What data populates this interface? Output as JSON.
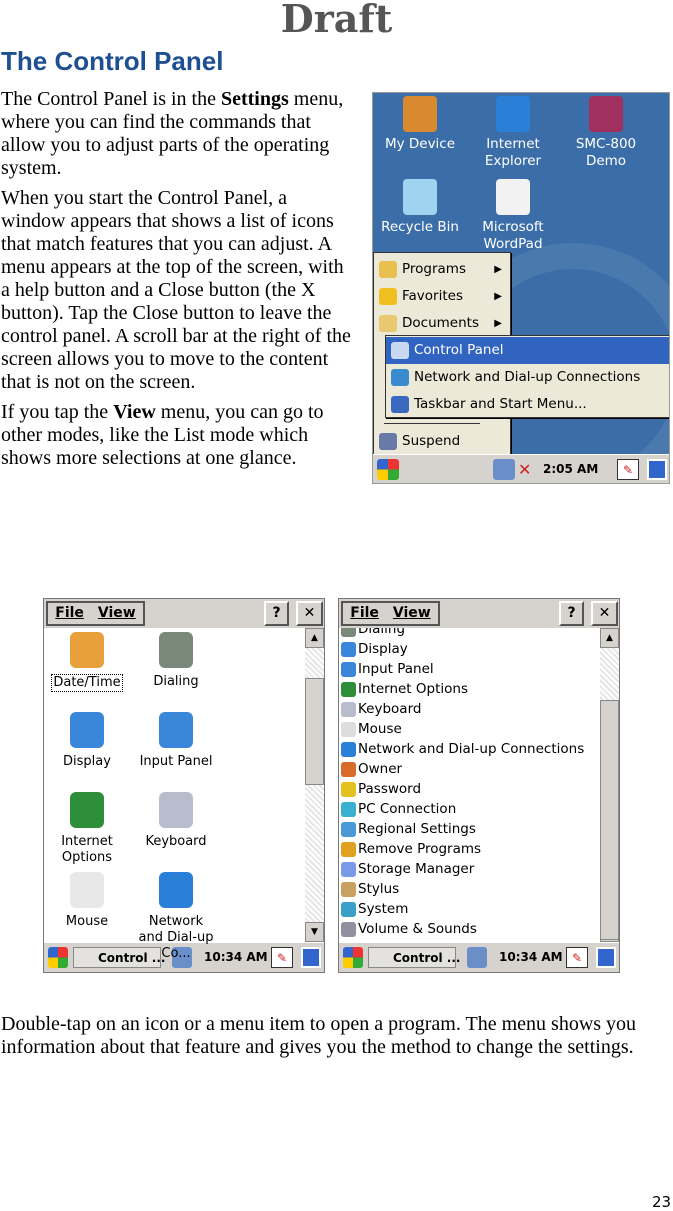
{
  "watermark": "Draft",
  "heading": "The Control Panel",
  "paragraphs": [
    {
      "before": "The Control Panel is in the ",
      "bold": "Settings",
      "after": " menu, where you can find the commands that allow you to adjust parts of the operating system."
    },
    {
      "before": "When you start the Control Panel, a window appears that shows a list of icons that match features that you can adjust. A menu appears at the top of the screen, with a help button and a Close button (the X button). Tap the Close button to leave the control panel. A scroll bar at the right of the screen allows you to move to the content that is not on the screen.",
      "bold": "",
      "after": ""
    },
    {
      "before": "If you tap the ",
      "bold": "View",
      "after": " menu, you can go to other modes, like the List mode which shows more selections at one glance."
    }
  ],
  "closing": "Double-tap on an icon or a menu item to open a program. The menu shows you information about that feature and gives you the method to change the settings.",
  "page_number": "23",
  "desktop": {
    "icons": [
      {
        "label": "My Device",
        "icon": "pda-icon",
        "color": "#d9892e"
      },
      {
        "label": "Internet Explorer",
        "icon": "ie-icon",
        "color": "#2a7fd6"
      },
      {
        "label": "SMC-800 Demo",
        "icon": "smc-icon",
        "color": "#a03060"
      },
      {
        "label": "Recycle Bin",
        "icon": "recycle-bin-icon",
        "color": "#9fd3f0"
      },
      {
        "label": "Microsoft WordPad",
        "icon": "wordpad-icon",
        "color": "#f2f2f2"
      }
    ],
    "start_menu": [
      {
        "label": "Programs",
        "icon": "programs-icon",
        "submenu": true
      },
      {
        "label": "Favorites",
        "icon": "favorites-star-icon",
        "submenu": true
      },
      {
        "label": "Documents",
        "icon": "documents-icon",
        "submenu": true
      },
      {
        "label": "Suspend",
        "icon": "suspend-icon",
        "submenu": false
      }
    ],
    "settings_submenu": [
      {
        "label": "Control Panel",
        "icon": "control-panel-icon",
        "selected": true
      },
      {
        "label": "Network and Dial-up Connections",
        "icon": "network-icon",
        "selected": false
      },
      {
        "label": "Taskbar and Start Menu...",
        "icon": "taskbar-icon",
        "selected": false
      }
    ],
    "taskbar": {
      "time": "2:05 AM"
    },
    "highlight_color": "#3163c0"
  },
  "window": {
    "menu": [
      "File",
      "View"
    ],
    "help": "?",
    "close": "✕",
    "taskbar": {
      "task": "Control ...",
      "time": "10:34 AM"
    }
  },
  "icon_view": [
    {
      "label": "Date/Time",
      "color": "#e8a03a"
    },
    {
      "label": "Dialing",
      "color": "#7a8a7a"
    },
    {
      "label": "Display",
      "color": "#3a86d8"
    },
    {
      "label": "Input Panel",
      "color": "#3a86d8"
    },
    {
      "label": "Internet Options",
      "color": "#2f8e3a"
    },
    {
      "label": "Keyboard",
      "color": "#b8bccc"
    },
    {
      "label": "Mouse",
      "color": "#e8e8e8"
    },
    {
      "label": "Network and Dial-up Co...",
      "color": "#2a7fd6"
    }
  ],
  "list_view": [
    {
      "label": "Dialing",
      "color": "#7a8a7a"
    },
    {
      "label": "Display",
      "color": "#3a86d8"
    },
    {
      "label": "Input Panel",
      "color": "#3a86d8"
    },
    {
      "label": "Internet Options",
      "color": "#2f8e3a"
    },
    {
      "label": "Keyboard",
      "color": "#b8bccc"
    },
    {
      "label": "Mouse",
      "color": "#dddddd"
    },
    {
      "label": "Network and Dial-up Connections",
      "color": "#2a7fd6"
    },
    {
      "label": "Owner",
      "color": "#d86a2a"
    },
    {
      "label": "Password",
      "color": "#e3c11f"
    },
    {
      "label": "PC Connection",
      "color": "#3ab0d0"
    },
    {
      "label": "Regional Settings",
      "color": "#4a9ad8"
    },
    {
      "label": "Remove Programs",
      "color": "#e0a020"
    },
    {
      "label": "Storage Manager",
      "color": "#7a9ae8"
    },
    {
      "label": "Stylus",
      "color": "#c8a060"
    },
    {
      "label": "System",
      "color": "#3aa0c8"
    },
    {
      "label": "Volume & Sounds",
      "color": "#9090a0"
    }
  ]
}
